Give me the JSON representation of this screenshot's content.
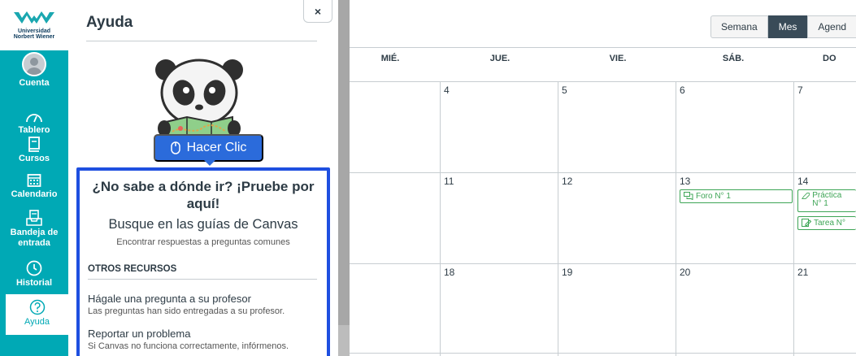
{
  "university": {
    "line1": "Universidad",
    "line2": "Norbert Wiener"
  },
  "global_nav": {
    "items": [
      {
        "id": "account",
        "label": "Cuenta",
        "icon": "user-avatar-icon"
      },
      {
        "id": "dashboard",
        "label": "Tablero",
        "icon": "speedometer-icon"
      },
      {
        "id": "courses",
        "label": "Cursos",
        "icon": "book-icon"
      },
      {
        "id": "calendar",
        "label": "Calendario",
        "icon": "calendar-icon"
      },
      {
        "id": "inbox",
        "label": "Bandeja de entrada",
        "icon": "inbox-icon"
      },
      {
        "id": "history",
        "label": "Historial",
        "icon": "clock-icon"
      },
      {
        "id": "help",
        "label": "Ayuda",
        "icon": "question-circle-icon",
        "active": true
      }
    ]
  },
  "help_tray": {
    "title": "Ayuda",
    "close_glyph": "×",
    "click_button": "Hacer Clic",
    "question": "¿No sabe a dónde ir? ¡Pruebe por aquí!",
    "guides_title": "Busque en las guías de Canvas",
    "guides_subtitle": "Encontrar respuestas a preguntas comunes",
    "section_title": "OTROS RECURSOS",
    "resources": [
      {
        "title": "Hágale una pregunta a su profesor",
        "desc": "Las preguntas han sido entregadas a su profesor."
      },
      {
        "title": "Reportar un problema",
        "desc": "Si Canvas no funciona correctamente, infórmenos."
      }
    ]
  },
  "calendar": {
    "views": [
      {
        "label": "Semana",
        "active": false
      },
      {
        "label": "Mes",
        "active": true
      },
      {
        "label": "Agend",
        "active": false
      }
    ],
    "day_headers": [
      "MIÉ.",
      "JUE.",
      "VIE.",
      "SÁB.",
      "DO"
    ],
    "weeks": [
      [
        "",
        "4",
        "5",
        "6",
        "7"
      ],
      [
        "",
        "11",
        "12",
        "13",
        "14"
      ],
      [
        "",
        "18",
        "19",
        "20",
        "21"
      ]
    ],
    "events": {
      "forum": "Foro N° 1",
      "practice": "Práctica N° 1",
      "task": "Tarea N°"
    }
  },
  "colors": {
    "nav_bg": "#00a9b5",
    "accent_blue": "#1e4fe0",
    "button_blue": "#2b6bdb",
    "event_green": "#3ea556",
    "active_view": "#394b58"
  }
}
